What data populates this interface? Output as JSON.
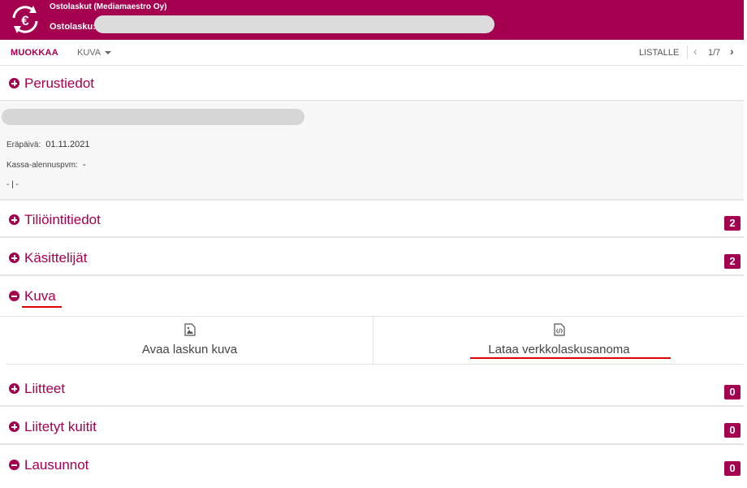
{
  "header": {
    "app_title": "Ostolaskut (Mediamaestro Oy)",
    "doc_label": "Ostolasku:",
    "logo_icon": "euro-refresh-icon"
  },
  "toolbar": {
    "edit_label": "MUOKKAA",
    "image_label": "KUVA",
    "list_label": "LISTALLE",
    "pager": "1/7",
    "prev_icon": "‹",
    "next_icon": "›"
  },
  "sections": {
    "perustiedot": {
      "title": "Perustiedot",
      "expanded": true
    },
    "tiliointitiedot": {
      "title": "Tiliöintitiedot",
      "badge": "2"
    },
    "kasittelijat": {
      "title": "Käsittelijät",
      "badge": "2"
    },
    "kuva": {
      "title": "Kuva",
      "expanded": true
    },
    "liitteet": {
      "title": "Liitteet",
      "badge": "0"
    },
    "liitetyt_kuitit": {
      "title": "Liitetyt kuitit",
      "badge": "0"
    },
    "lausunnot": {
      "title": "Lausunnot",
      "badge": "0",
      "expanded": true
    }
  },
  "details": {
    "due_date_label": "Eräpäivä:",
    "due_date_value": "01.11.2021",
    "cash_discount_label": "Kassa-alennuspvm:",
    "cash_discount_value": "-",
    "misc_line": "- | -"
  },
  "kuva_actions": {
    "open_image_label": "Avaa laskun kuva",
    "open_image_icon": "image-icon",
    "download_label": "Lataa verkkolaskusanoma",
    "download_icon": "code-file-icon"
  },
  "colors": {
    "brand": "#a5004f",
    "highlight": "#e00000",
    "redacted": "#dcdcdc"
  }
}
